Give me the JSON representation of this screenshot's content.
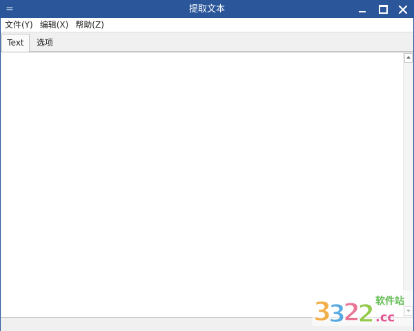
{
  "window": {
    "title": "提取文本",
    "system_menu_icon": "system-menu-icon",
    "controls": [
      "minimize-icon",
      "maximize-icon",
      "close-icon"
    ]
  },
  "menubar": {
    "items": [
      {
        "label": "文件(Y)"
      },
      {
        "label": "编辑(X)"
      },
      {
        "label": "帮助(Z)"
      }
    ]
  },
  "tabs": [
    {
      "label": "Text",
      "active": true
    },
    {
      "label": "选项",
      "active": false
    }
  ],
  "editor": {
    "value": ""
  },
  "watermark": {
    "number": "3322",
    "suffix": ".cc",
    "site": "软件站"
  },
  "colors": {
    "titlebar": "#2b579a",
    "window_bg": "#f0f0f0",
    "editor_bg": "#ffffff"
  }
}
